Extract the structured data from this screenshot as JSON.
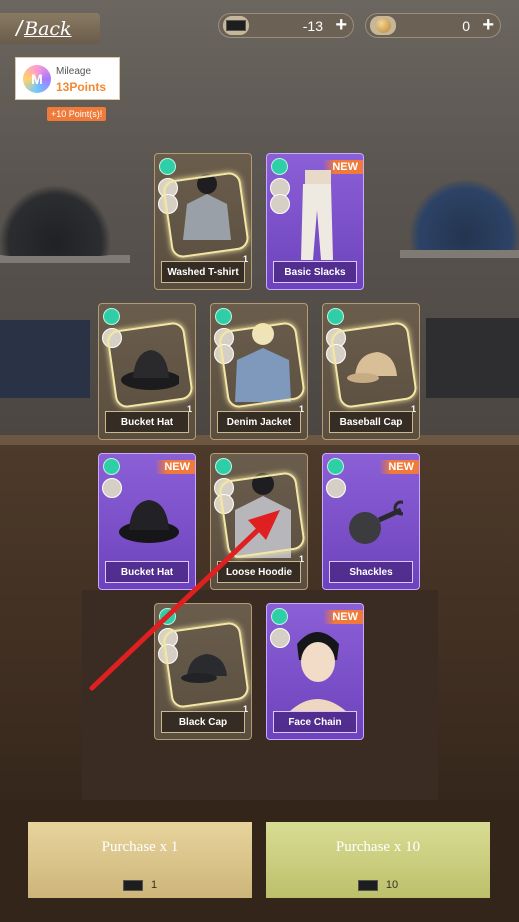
{
  "header": {
    "back_label": "Back",
    "tickets": {
      "icon": "ticket-icon",
      "value": "-13",
      "plus": "+"
    },
    "coins": {
      "icon": "coin-icon",
      "value": "0",
      "plus": "+"
    }
  },
  "mileage": {
    "icon_letter": "M",
    "title": "Mileage",
    "points": "13Points",
    "bonus": "+10 Point(s)!"
  },
  "cards": [
    {
      "name": "Washed T-shirt",
      "style": "brown",
      "new": false,
      "qty": "1"
    },
    {
      "name": "Basic Slacks",
      "style": "purple",
      "new": true,
      "qty": ""
    },
    {
      "name": "Bucket Hat",
      "style": "brown",
      "new": false,
      "qty": "1"
    },
    {
      "name": "Denim Jacket",
      "style": "brown",
      "new": false,
      "qty": "1"
    },
    {
      "name": "Baseball Cap",
      "style": "brown",
      "new": false,
      "qty": "1"
    },
    {
      "name": "Bucket Hat",
      "style": "purple",
      "new": true,
      "qty": ""
    },
    {
      "name": "Loose Hoodie",
      "style": "brown",
      "new": false,
      "qty": "1"
    },
    {
      "name": "Shackles",
      "style": "purple",
      "new": true,
      "qty": ""
    },
    {
      "name": "Black Cap",
      "style": "brown",
      "new": false,
      "qty": "1"
    },
    {
      "name": "Face Chain",
      "style": "purple",
      "new": true,
      "qty": ""
    }
  ],
  "new_label": "NEW",
  "purchase": {
    "one": {
      "label": "Purchase x 1",
      "cost": "1"
    },
    "ten": {
      "label": "Purchase x 10",
      "cost": "10"
    }
  },
  "colors": {
    "purple_card": "#7a4fcb",
    "brown_card": "#625646",
    "new_badge": "#f07a3a",
    "arrow": "#e02020"
  }
}
